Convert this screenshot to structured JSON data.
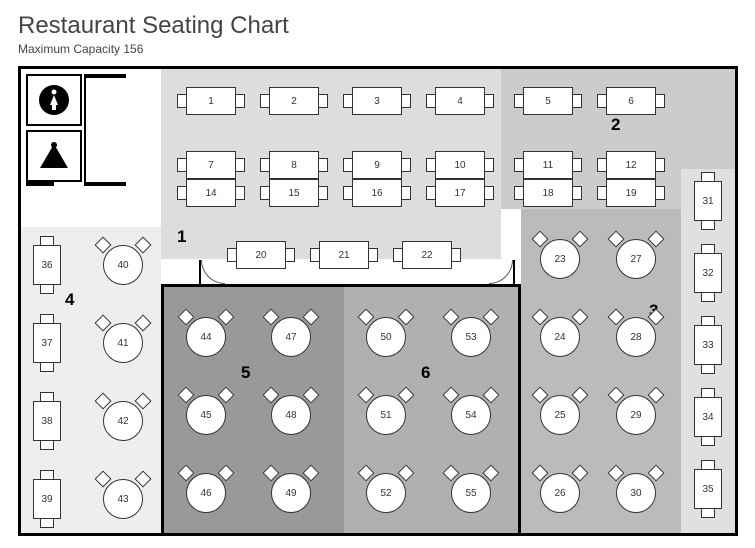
{
  "title": "Restaurant Seating Chart",
  "subtitle": "Maximum Capacity 156",
  "sections": {
    "s1": "1",
    "s2": "2",
    "s3": "3",
    "s4": "4",
    "s5": "5",
    "s6": "6"
  },
  "restrooms": {
    "female": "womens-restroom",
    "male": "mens-restroom"
  },
  "tables": {
    "t1": "1",
    "t2": "2",
    "t3": "3",
    "t4": "4",
    "t5": "5",
    "t6": "6",
    "t7": "7",
    "t8": "8",
    "t9": "9",
    "t10": "10",
    "t11": "11",
    "t12": "12",
    "t14": "14",
    "t15": "15",
    "t16": "16",
    "t17": "17",
    "t18": "18",
    "t19": "19",
    "t20": "20",
    "t21": "21",
    "t22": "22",
    "t23": "23",
    "t24": "24",
    "t25": "25",
    "t26": "26",
    "t27": "27",
    "t28": "28",
    "t29": "29",
    "t30": "30",
    "t31": "31",
    "t32": "32",
    "t33": "33",
    "t34": "34",
    "t35": "35",
    "t36": "36",
    "t37": "37",
    "t38": "38",
    "t39": "39",
    "t40": "40",
    "t41": "41",
    "t42": "42",
    "t43": "43",
    "t44": "44",
    "t45": "45",
    "t46": "46",
    "t47": "47",
    "t48": "48",
    "t49": "49",
    "t50": "50",
    "t51": "51",
    "t52": "52",
    "t53": "53",
    "t54": "54",
    "t55": "55"
  }
}
